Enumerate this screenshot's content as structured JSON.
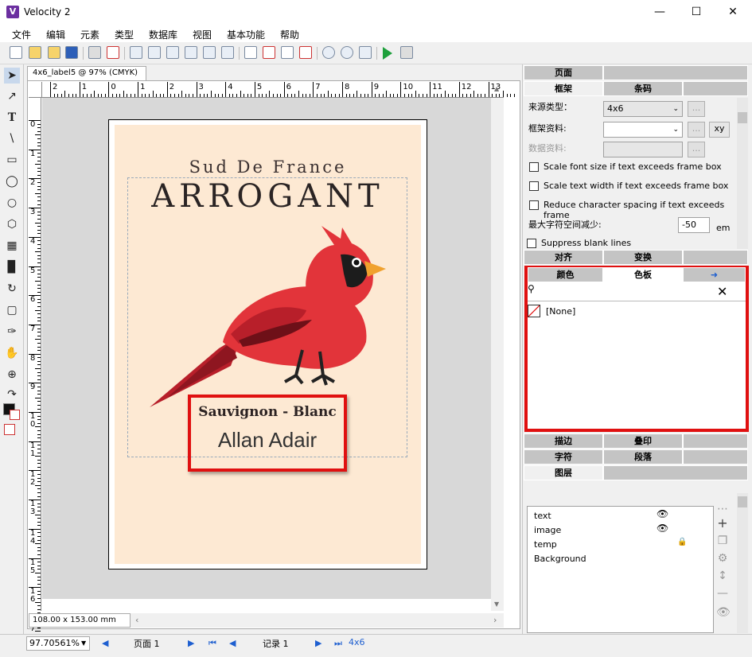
{
  "window": {
    "title": "Velocity 2",
    "icon": "V"
  },
  "menu": [
    "文件",
    "编辑",
    "元素",
    "类型",
    "数据库",
    "视图",
    "基本功能",
    "帮助"
  ],
  "document": {
    "tab": "4x6_label5 @ 97% (CMYK)",
    "page_size": "108.00 x 153.00 mm"
  },
  "ruler": {
    "h": [
      "2",
      "1",
      "0",
      "1",
      "2",
      "3",
      "4",
      "5",
      "6",
      "7",
      "8",
      "9",
      "10",
      "11",
      "12",
      "13"
    ],
    "v": [
      "0",
      "1",
      "2",
      "3",
      "4",
      "5",
      "6",
      "7",
      "8",
      "9",
      "1 0",
      "1 1",
      "1 2",
      "1 3",
      "1 4",
      "1 5",
      "1 6",
      "1 7"
    ]
  },
  "label": {
    "subtitle": "Sud De France",
    "title": "ARROGANT",
    "wine_type": "Sauvignon - Blanc",
    "maker": "Allan Adair",
    "bg_color": "#fde9d3"
  },
  "status": {
    "zoom": "97.70561%",
    "page": "页面 1",
    "record": "记录 1",
    "layout": "4x6"
  },
  "panel": {
    "top_tabs": [
      "页面",
      ""
    ],
    "frame_tabs": [
      "框架",
      "条码",
      ""
    ],
    "source_type_label": "来源类型：",
    "source_type_value": "4x6",
    "frame_data_label": "框架资料:",
    "data_data_label": "数据资料:",
    "xy_button": "xy",
    "checks": [
      "Scale font size if text exceeds frame box",
      "Scale text width if text exceeds frame box",
      "Reduce character spacing if text exceeds frame"
    ],
    "max_spacing_label": "最大字符空间减少:",
    "max_spacing_value": "-50",
    "max_spacing_unit": "em",
    "suppress_label": "Suppress blank lines",
    "row1": [
      "对齐",
      "变换",
      ""
    ],
    "row2": [
      "颜色",
      "色板",
      ""
    ],
    "swatch_none": "[None]",
    "row3": [
      "描边",
      "叠印",
      ""
    ],
    "row4": [
      "字符",
      "段落",
      ""
    ],
    "row5": [
      "图层",
      ""
    ],
    "layers": [
      {
        "name": "text",
        "visible": true,
        "locked": false
      },
      {
        "name": "image",
        "visible": true,
        "locked": false
      },
      {
        "name": "temp",
        "visible": false,
        "locked": true
      },
      {
        "name": "Background",
        "visible": false,
        "locked": false
      }
    ]
  },
  "colors": {
    "highlight": "#e01010",
    "accent": "#1e5fd0",
    "cardinal": "#e2343a"
  }
}
